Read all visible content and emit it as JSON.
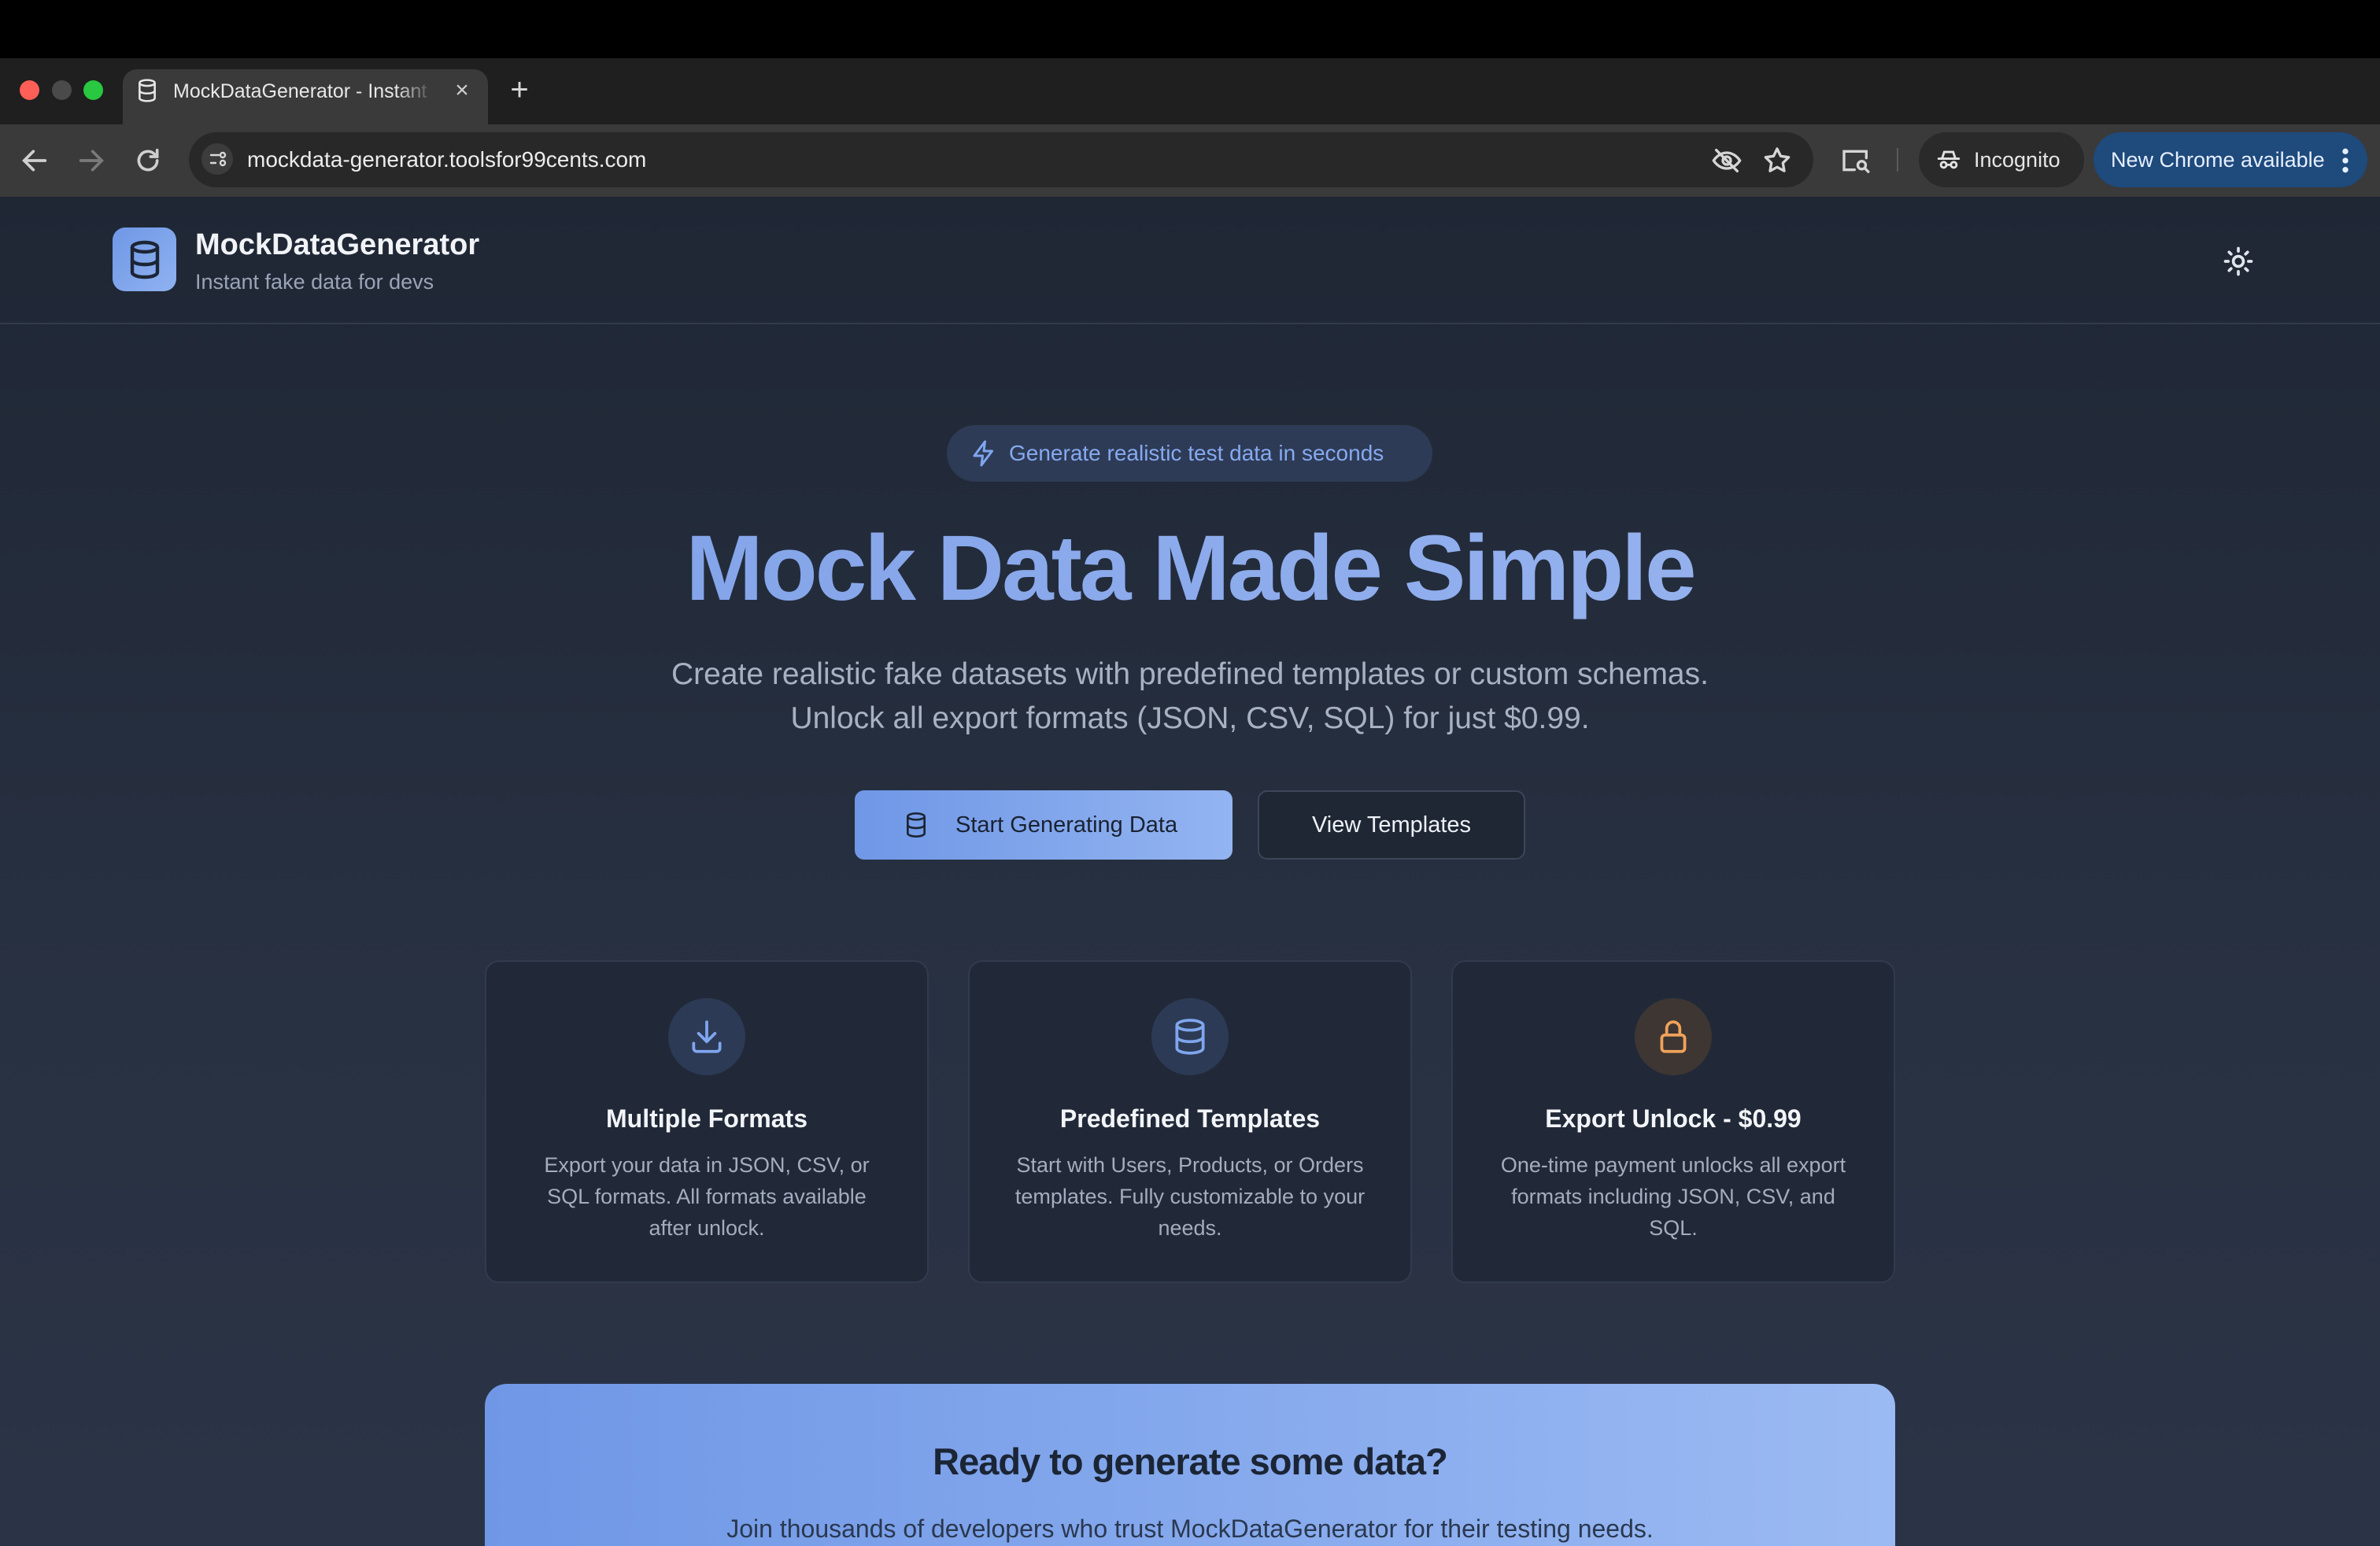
{
  "browser": {
    "tab": {
      "title": "MockDataGenerator - Instant fake data for devs",
      "close_icon": "×"
    },
    "new_tab_icon": "+",
    "url": "mockdata-generator.toolsfor99cents.com",
    "incognito_label": "Incognito",
    "update_label": "New Chrome available"
  },
  "header": {
    "brand_name": "MockDataGenerator",
    "tagline": "Instant fake data for devs"
  },
  "hero": {
    "badge": "Generate realistic test data in seconds",
    "title": "Mock Data Made Simple",
    "subtitle_line1": "Create realistic fake datasets with predefined templates or custom schemas.",
    "subtitle_line2": "Unlock all export formats (JSON, CSV, SQL) for just $0.99.",
    "primary_button": "Start Generating Data",
    "secondary_button": "View Templates"
  },
  "features": [
    {
      "icon": "download-icon",
      "title": "Multiple Formats",
      "body": "Export your data in JSON, CSV, or SQL formats. All formats available after unlock."
    },
    {
      "icon": "database-icon",
      "title": "Predefined Templates",
      "body": "Start with Users, Products, or Orders templates. Fully customizable to your needs."
    },
    {
      "icon": "lock-icon",
      "title": "Export Unlock - $0.99",
      "body": "One-time payment unlocks all export formats including JSON, CSV, and SQL."
    }
  ],
  "cta": {
    "title": "Ready to generate some data?",
    "subtitle": "Join thousands of developers who trust MockDataGenerator for their testing needs."
  },
  "colors": {
    "accent": "#7a9ce6",
    "accent_light": "#9bbaf3",
    "lock_accent": "#f0a25a",
    "page_bg": "#242d3c"
  }
}
